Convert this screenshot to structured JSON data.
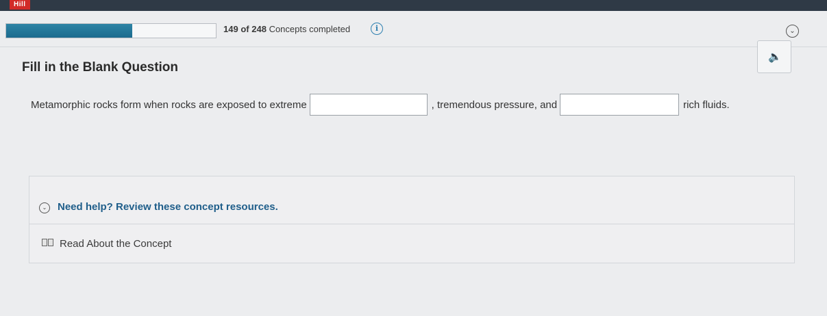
{
  "app": {
    "logo_text": "Hill"
  },
  "progress": {
    "completed": "149",
    "separator": "of",
    "total": "248",
    "label": "Concepts completed",
    "fraction": 0.6008,
    "fill_color": "#1f6f92"
  },
  "question": {
    "title": "Fill in the Blank Question",
    "sentence_part1": "Metamorphic rocks form when rocks are exposed to extreme",
    "sentence_part2": ", tremendous pressure, and",
    "sentence_part3": "rich fluids.",
    "blank1_value": "",
    "blank2_value": ""
  },
  "help": {
    "title": "Need help? Review these concept resources.",
    "resources": [
      {
        "label": "Read About the Concept",
        "icon": "book-icon"
      }
    ]
  },
  "icons": {
    "info": "info-icon",
    "collapse": "chevron-down-circle-icon",
    "audio": "speaker-icon"
  },
  "colors": {
    "accent": "#1f5e8a",
    "topbar": "#2f3a46",
    "logo": "#d22b28"
  }
}
